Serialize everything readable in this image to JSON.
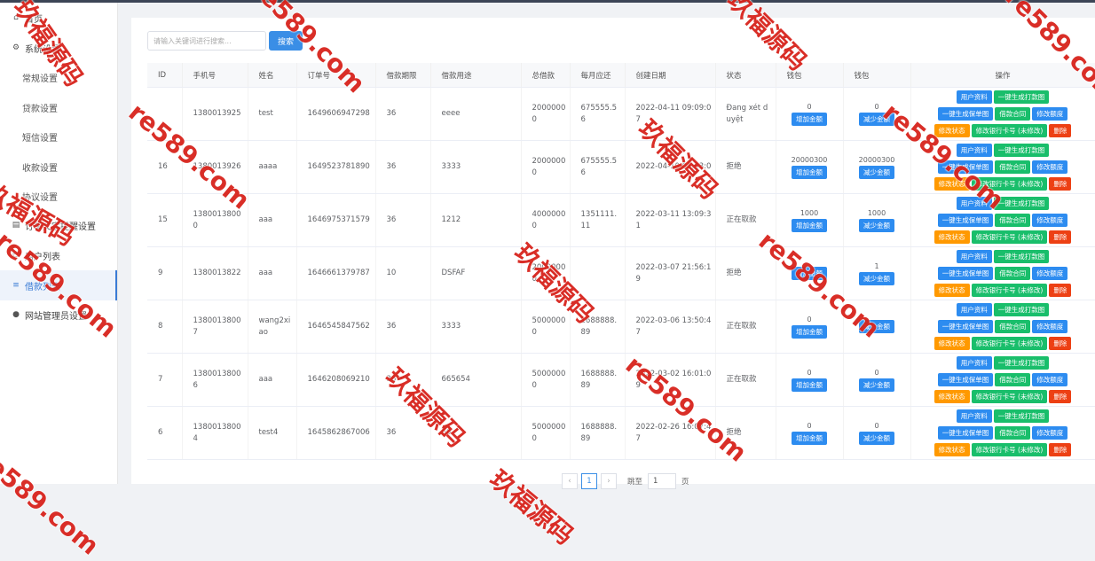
{
  "sidebar": {
    "items": [
      {
        "label": "首页",
        "icon": "home-icon",
        "glyph": "⌂"
      },
      {
        "label": "系统设置",
        "icon": "gear-icon",
        "glyph": "⚙"
      },
      {
        "label": "常规设置"
      },
      {
        "label": "贷款设置"
      },
      {
        "label": "短信设置"
      },
      {
        "label": "收款设置"
      },
      {
        "label": "协议设置"
      },
      {
        "label": "订单文字提醒设置",
        "icon": "document-icon",
        "glyph": "▤"
      },
      {
        "label": "用户列表",
        "icon": "users-icon",
        "glyph": "⚇"
      },
      {
        "label": "借款列表",
        "icon": "list-icon",
        "glyph": "≡"
      },
      {
        "label": "网站管理员设置",
        "icon": "user-icon",
        "glyph": "●"
      }
    ]
  },
  "search": {
    "placeholder": "请输入关键词进行搜索...",
    "button": "搜索"
  },
  "table": {
    "headers": [
      "ID",
      "手机号",
      "姓名",
      "订单号",
      "借款期限",
      "借款用途",
      "总借款",
      "每月应还",
      "创建日期",
      "状态",
      "钱包",
      "钱包",
      "操作"
    ],
    "rows": [
      {
        "id": "",
        "phone": "1380013925",
        "name": "test",
        "order": "1649606947298",
        "term": "36",
        "purpose": "eeee",
        "total": "20000000",
        "monthly": "675555.56",
        "date": "2022-04-11 09:09:07",
        "status": "Đang xét duyệt",
        "wallet1": "0",
        "wallet2": "0",
        "status_btn": "修改状态"
      },
      {
        "id": "16",
        "phone": "1380013926",
        "name": "aaaa",
        "order": "1649523781890",
        "term": "36",
        "purpose": "3333",
        "total": "20000000",
        "monthly": "675555.56",
        "date": "2022-04-10 01:03:0",
        "status": "拒绝",
        "wallet1": "20000300",
        "wallet2": "20000300",
        "status_btn": "修改状态"
      },
      {
        "id": "15",
        "phone": "13800138000",
        "name": "aaa",
        "order": "1646975371579",
        "term": "36",
        "purpose": "1212",
        "total": "40000000",
        "monthly": "1351111.11",
        "date": "2022-03-11 13:09:31",
        "status": "正在取款",
        "wallet1": "1000",
        "wallet2": "1000",
        "status_btn": "修改状态"
      },
      {
        "id": "9",
        "phone": "1380013822",
        "name": "aaa",
        "order": "1646661379787",
        "term": "10",
        "purpose": "DSFAF",
        "total": "20000000",
        "monthly": "",
        "date": "2022-03-07 21:56:19",
        "status": "拒绝",
        "wallet1": "",
        "wallet2": "1",
        "status_btn": "修改状态"
      },
      {
        "id": "8",
        "phone": "13800138007",
        "name": "wang2xiao",
        "order": "1646545847562",
        "term": "36",
        "purpose": "3333",
        "total": "50000000",
        "monthly": "1688888.89",
        "date": "2022-03-06 13:50:47",
        "status": "正在取款",
        "wallet1": "0",
        "wallet2": "",
        "status_btn": "修改状态"
      },
      {
        "id": "7",
        "phone": "13800138006",
        "name": "aaa",
        "order": "1646208069210",
        "term": "36",
        "purpose": "665654",
        "total": "50000000",
        "monthly": "1688888.89",
        "date": "2022-03-02 16:01:09",
        "status": "正在取款",
        "wallet1": "0",
        "wallet2": "0",
        "status_btn": "修改状态"
      },
      {
        "id": "6",
        "phone": "13800138004",
        "name": "test4",
        "order": "1645862867006",
        "term": "36",
        "purpose": "66",
        "total": "50000000",
        "monthly": "1688888.89",
        "date": "2022-02-26 16:07:47",
        "status": "拒绝",
        "wallet1": "0",
        "wallet2": "0",
        "status_btn": "修改状态"
      }
    ],
    "buttons": {
      "add": "增加金额",
      "reduce": "减少金额",
      "user_info": "用户资料",
      "gen_receipt": "一键生成打款图",
      "gen_guarantee": "一键生成保单图",
      "contract": "借款合同",
      "edit_amount": "修改额度",
      "edit_bank": "修改银行卡号 (未修改)",
      "delete": "删除"
    }
  },
  "pager": {
    "prev": "‹",
    "current": "1",
    "next": "›",
    "jump_label": "跳至",
    "jump_value": "1",
    "page_suffix": "页"
  },
  "watermarks": [
    "玖福源码",
    "re589.com"
  ],
  "colors": {
    "primary": "#3a8ee6",
    "green": "#19be6b",
    "orange": "#ff9900",
    "red": "#ed4014"
  }
}
